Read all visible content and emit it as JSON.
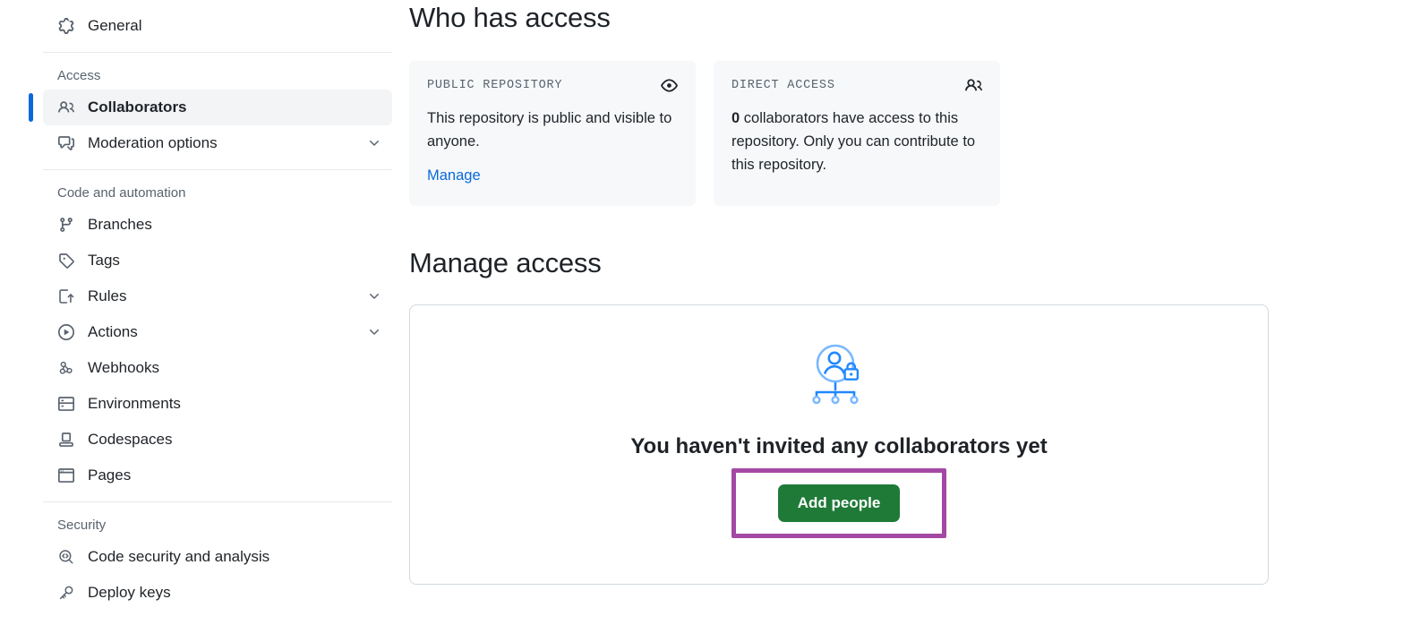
{
  "sidebar": {
    "top_items": [
      {
        "label": "General",
        "icon": "gear-icon",
        "name": "general",
        "expandable": false
      }
    ],
    "sections": [
      {
        "title": "Access",
        "name": "access",
        "items": [
          {
            "label": "Collaborators",
            "icon": "people-icon",
            "name": "collaborators",
            "expandable": false,
            "active": true
          },
          {
            "label": "Moderation options",
            "icon": "comment-discussion-icon",
            "name": "moderation-options",
            "expandable": true,
            "active": false
          }
        ]
      },
      {
        "title": "Code and automation",
        "name": "code-and-automation",
        "items": [
          {
            "label": "Branches",
            "icon": "git-branch-icon",
            "name": "branches",
            "expandable": false,
            "active": false
          },
          {
            "label": "Tags",
            "icon": "tag-icon",
            "name": "tags",
            "expandable": false,
            "active": false
          },
          {
            "label": "Rules",
            "icon": "rules-icon",
            "name": "rules",
            "expandable": true,
            "active": false
          },
          {
            "label": "Actions",
            "icon": "play-icon",
            "name": "actions",
            "expandable": true,
            "active": false
          },
          {
            "label": "Webhooks",
            "icon": "webhook-icon",
            "name": "webhooks",
            "expandable": false,
            "active": false
          },
          {
            "label": "Environments",
            "icon": "server-icon",
            "name": "environments",
            "expandable": false,
            "active": false
          },
          {
            "label": "Codespaces",
            "icon": "codespaces-icon",
            "name": "codespaces",
            "expandable": false,
            "active": false
          },
          {
            "label": "Pages",
            "icon": "browser-icon",
            "name": "pages",
            "expandable": false,
            "active": false
          }
        ]
      },
      {
        "title": "Security",
        "name": "security",
        "items": [
          {
            "label": "Code security and analysis",
            "icon": "codescan-icon",
            "name": "code-security-and-analysis",
            "expandable": false,
            "active": false
          },
          {
            "label": "Deploy keys",
            "icon": "key-icon",
            "name": "deploy-keys",
            "expandable": false,
            "active": false
          }
        ]
      }
    ]
  },
  "main": {
    "who_has_access": {
      "heading": "Who has access",
      "cards": [
        {
          "title": "PUBLIC REPOSITORY",
          "icon": "eye-icon",
          "body": "This repository is public and visible to anyone.",
          "link": "Manage"
        },
        {
          "title": "DIRECT ACCESS",
          "icon": "people-icon",
          "body_strong": "0",
          "body_rest": " collaborators have access to this repository. Only you can contribute to this repository."
        }
      ]
    },
    "manage_access": {
      "heading": "Manage access",
      "empty_state": {
        "illustration": "person-lock-hierarchy-illustration",
        "title": "You haven't invited any collaborators yet",
        "button_label": "Add people"
      }
    }
  },
  "colors": {
    "accent_blue": "#0969da",
    "success_green": "#1f7a37",
    "annotation_purple": "#a349a4",
    "card_bg": "#f6f8fa",
    "border": "#d1d9e0",
    "muted_text": "#59636e",
    "illustration_light_blue": "#79b8ff",
    "illustration_blue": "#2188ff"
  }
}
